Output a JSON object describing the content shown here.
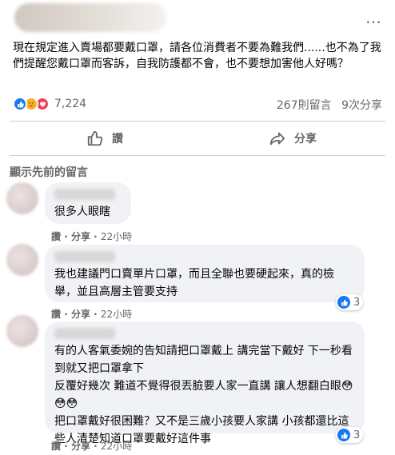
{
  "post": {
    "more_icon": "…",
    "text": "現在規定進入賣場都要戴口罩，請各位消費者不要為難我們......也不為了我們提醒您戴口罩而客訴，自我防護都不會，也不要想加害他人好嗎？",
    "reaction_count": "7,224",
    "comments_count": "267則留言",
    "shares_count": "9次分享"
  },
  "actions": {
    "like_label": "讚",
    "share_label": "分享"
  },
  "previous_comments_label": "顯示先前的留言",
  "comments": [
    {
      "text": "很多人眼瞎",
      "like_label": "讚",
      "reply_label": "分享",
      "time": "22小時"
    },
    {
      "text": "我也建議門口賣單片口罩，而且全聯也要硬起來，真的檢舉，並且高層主管要支持",
      "like_label": "讚",
      "reply_label": "分享",
      "time": "22小時",
      "reactions": "3"
    },
    {
      "text": "有的人客氣委婉的告知請把口罩戴上 講完當下戴好 下一秒看到就又把口罩拿下\n反覆好幾次 難道不覺得很丟臉要人家一直講 讓人想翻白眼😳😳😳\n把口罩戴好很困難？又不是三歲小孩要人家講 小孩都還比這些人清楚知道口罩要戴好這件事",
      "like_label": "讚",
      "reply_label": "分享",
      "time": "22小時",
      "reactions": "3"
    }
  ],
  "colors": {
    "accent": "#1877f2",
    "secondary_text": "#65676b",
    "bubble": "#f0f2f5"
  }
}
